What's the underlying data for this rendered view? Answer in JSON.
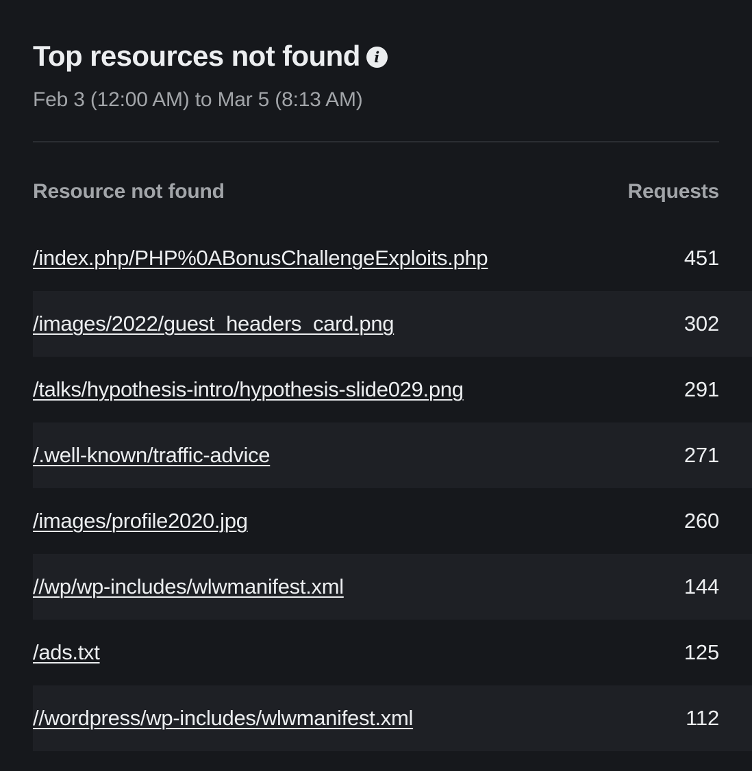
{
  "panel": {
    "title": "Top resources not found",
    "info_icon": "info-icon",
    "date_range": "Feb 3 (12:00 AM) to Mar 5 (8:13 AM)"
  },
  "table": {
    "columns": {
      "resource": "Resource not found",
      "requests": "Requests"
    },
    "rows": [
      {
        "resource": "/index.php/PHP%0ABonusChallengeExploits.php",
        "requests": "451"
      },
      {
        "resource": "/images/2022/guest_headers_card.png",
        "requests": "302"
      },
      {
        "resource": "/talks/hypothesis-intro/hypothesis-slide029.png",
        "requests": "291"
      },
      {
        "resource": "/.well-known/traffic-advice",
        "requests": "271"
      },
      {
        "resource": "/images/profile2020.jpg",
        "requests": "260"
      },
      {
        "resource": "//wp/wp-includes/wlwmanifest.xml",
        "requests": "144"
      },
      {
        "resource": "/ads.txt",
        "requests": "125"
      },
      {
        "resource": "//wordpress/wp-includes/wlwmanifest.xml",
        "requests": "112"
      }
    ]
  },
  "colors": {
    "background": "#16181c",
    "row_alt": "#1e2025",
    "text": "#eceef0",
    "muted": "#a2a5a9",
    "divider": "#2b2e33"
  }
}
